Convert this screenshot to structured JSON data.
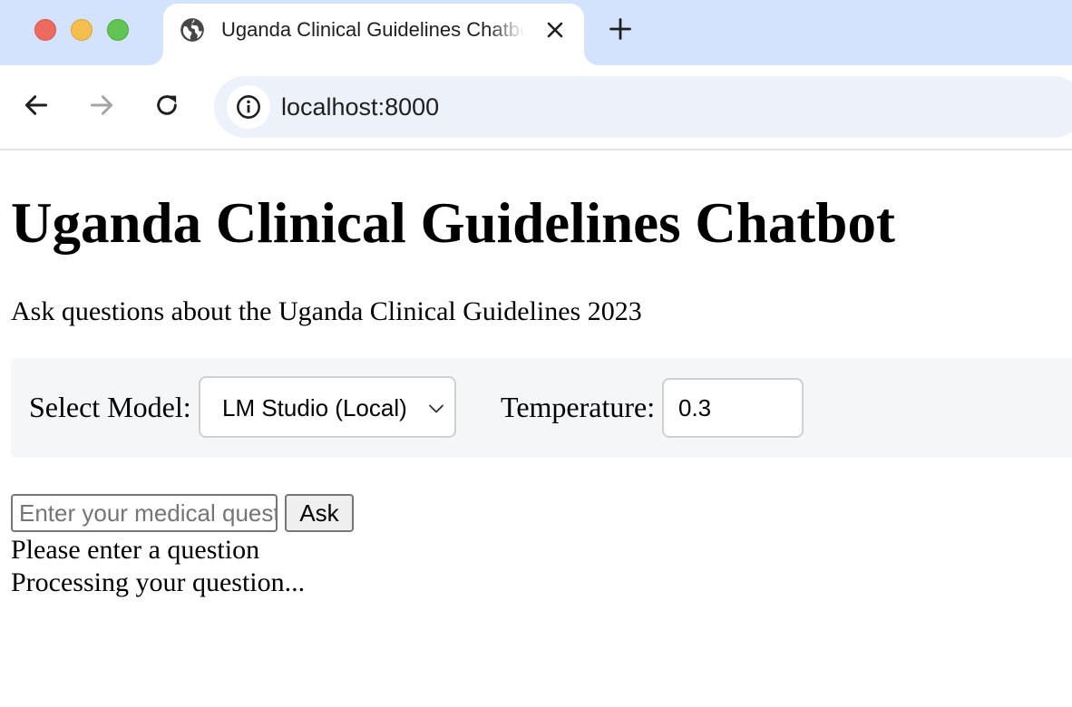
{
  "browser": {
    "tab_title": "Uganda Clinical Guidelines Chatbot",
    "url": "localhost:8000",
    "tab_bar_color": "#d3e3fd"
  },
  "page": {
    "title": "Uganda Clinical Guidelines Chatbot",
    "subtitle": "Ask questions about the Uganda Clinical Guidelines 2023",
    "controls": {
      "model_label": "Select Model:",
      "model_selected": "LM Studio (Local)",
      "temperature_label": "Temperature:",
      "temperature_value": "0.3"
    },
    "question": {
      "placeholder": "Enter your medical question",
      "value": "",
      "ask_label": "Ask"
    },
    "status": [
      "Please enter a question",
      "Processing your question..."
    ]
  }
}
